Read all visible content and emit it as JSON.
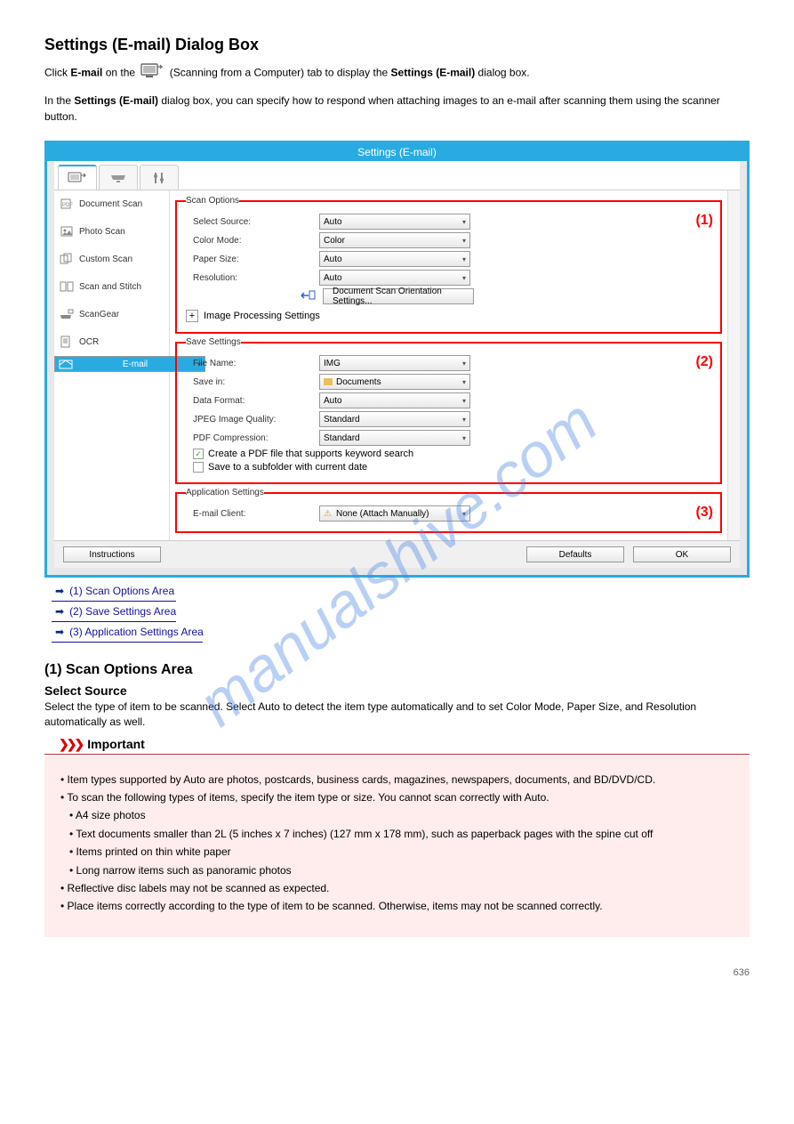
{
  "heading": "Settings (E-mail) Dialog Box",
  "intro_before": "Click ",
  "intro_mid": "E-mail",
  "intro_after": " on the ",
  "intro_tab": "(Scanning from a Computer) tab to display the ",
  "intro_dlg": "Settings (E-mail)",
  "intro_tail": " dialog box.",
  "intro2_a": "In the ",
  "intro2_b": "Settings (E-mail)",
  "intro2_c": " dialog box, you can specify how to respond when attaching images to an e-mail after scanning them using the scanner button.",
  "dialog_title": "Settings (E-mail)",
  "sidebar": [
    {
      "label": "Document Scan"
    },
    {
      "label": "Photo Scan"
    },
    {
      "label": "Custom Scan"
    },
    {
      "label": "Scan and Stitch"
    },
    {
      "label": "ScanGear"
    },
    {
      "label": "OCR"
    },
    {
      "label": "E-mail"
    }
  ],
  "scan": {
    "legend": "Scan Options",
    "num": "(1)",
    "select_source_lbl": "Select Source:",
    "select_source_val": "Auto",
    "color_mode_lbl": "Color Mode:",
    "color_mode_val": "Color",
    "paper_size_lbl": "Paper Size:",
    "paper_size_val": "Auto",
    "resolution_lbl": "Resolution:",
    "resolution_val": "Auto",
    "orient_btn": "Document Scan Orientation Settings...",
    "img_proc": "Image Processing Settings"
  },
  "save": {
    "legend": "Save Settings",
    "num": "(2)",
    "filename_lbl": "File Name:",
    "filename_val": "IMG",
    "savein_lbl": "Save in:",
    "savein_val": "Documents",
    "format_lbl": "Data Format:",
    "format_val": "Auto",
    "jpeg_lbl": "JPEG Image Quality:",
    "jpeg_val": "Standard",
    "pdf_lbl": "PDF Compression:",
    "pdf_val": "Standard",
    "chk1": "Create a PDF file that supports keyword search",
    "chk2": "Save to a subfolder with current date"
  },
  "app": {
    "legend": "Application Settings",
    "num": "(3)",
    "client_lbl": "E-mail Client:",
    "client_val": "None (Attach Manually)"
  },
  "footer": {
    "instructions": "Instructions",
    "defaults": "Defaults",
    "ok": "OK"
  },
  "links": [
    "(1) Scan Options Area",
    "(2) Save Settings Area",
    "(3) Application Settings Area"
  ],
  "section_h3": "(1) Scan Options Area",
  "select_source_h": "Select Source",
  "select_source_p": "Select the type of item to be scanned. Select Auto to detect the item type automatically and to set Color Mode, Paper Size, and Resolution automatically as well.",
  "important_label": "Important",
  "note_items": [
    "Item types supported by Auto are photos, postcards, business cards, magazines, newspapers, documents, and BD/DVD/CD.",
    "To scan the following types of items, specify the item type or size. You cannot scan correctly with Auto.",
    "A4 size photos",
    "Text documents smaller than 2L (5 inches x 7 inches) (127 mm x 178 mm), such as paperback pages with the spine cut off",
    "Items printed on thin white paper",
    "Long narrow items such as panoramic photos",
    "Reflective disc labels may not be scanned as expected.",
    "Place items correctly according to the type of item to be scanned. Otherwise, items may not be scanned correctly."
  ],
  "page_number": "636",
  "watermark": "manualshive.com"
}
